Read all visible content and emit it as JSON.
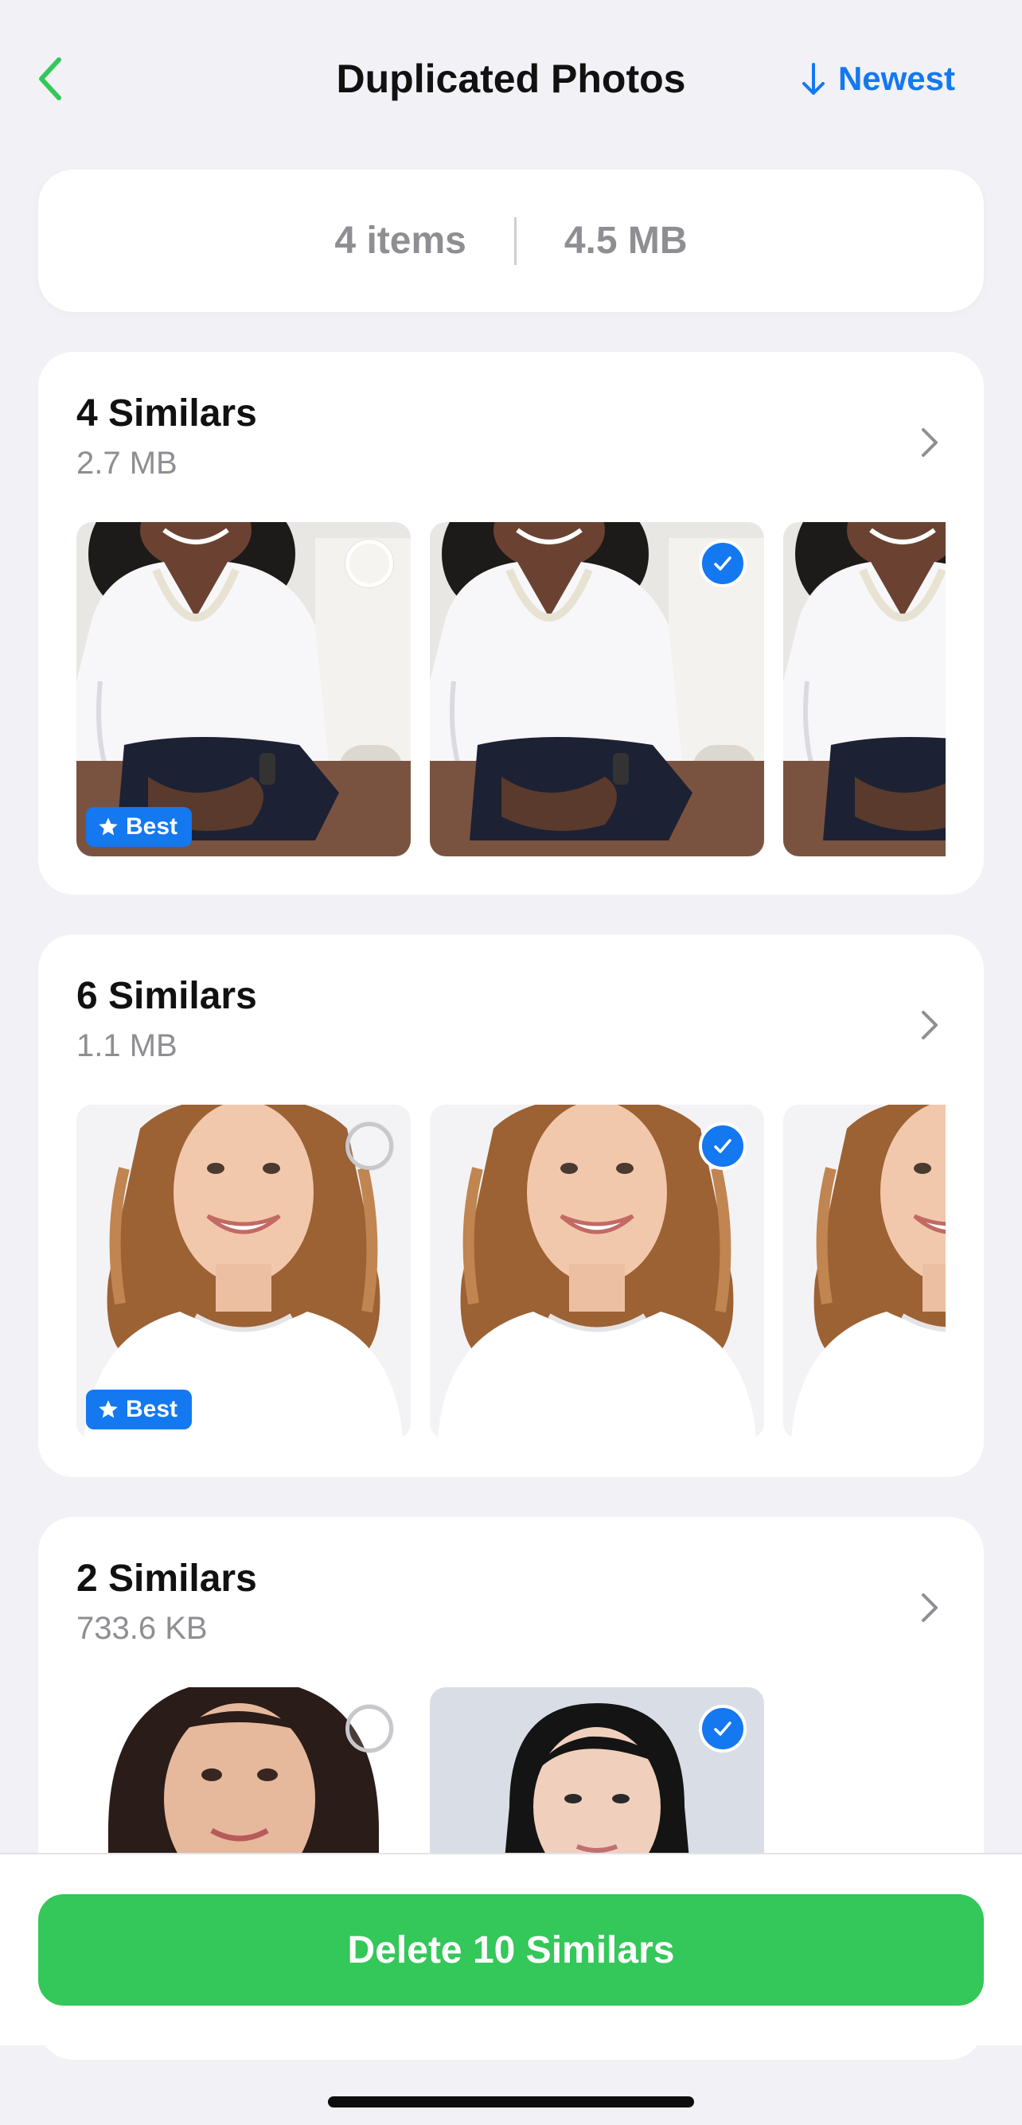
{
  "nav": {
    "title": "Duplicated Photos",
    "sort_label": "Newest",
    "back_icon": "chevron-left-icon",
    "sort_icon": "arrow-down-icon",
    "accent_back": "#34c759",
    "accent_sort": "#1478f0"
  },
  "summary": {
    "items": "4 items",
    "size": "4.5 MB"
  },
  "groups": [
    {
      "title": "4 Similars",
      "size": "2.7 MB",
      "photos": [
        {
          "subject": "woman-white-blouse",
          "selected": false,
          "best": true
        },
        {
          "subject": "woman-white-blouse",
          "selected": true,
          "best": false
        },
        {
          "subject": "woman-white-blouse",
          "selected": false,
          "best": false
        }
      ]
    },
    {
      "title": "6 Similars",
      "size": "1.1 MB",
      "photos": [
        {
          "subject": "woman-curly-hair",
          "selected": false,
          "best": true
        },
        {
          "subject": "woman-curly-hair",
          "selected": true,
          "best": false
        },
        {
          "subject": "woman-curly-hair",
          "selected": false,
          "best": false
        }
      ]
    },
    {
      "title": "2 Similars",
      "size": "733.6 KB",
      "photos": [
        {
          "subject": "woman-dark-hair",
          "selected": false,
          "best": false
        },
        {
          "subject": "woman-short-dark-hair",
          "selected": true,
          "best": false
        }
      ]
    }
  ],
  "badge": {
    "best_label": "Best"
  },
  "footer": {
    "delete_label": "Delete 10 Similars",
    "button_color": "#34c759"
  }
}
